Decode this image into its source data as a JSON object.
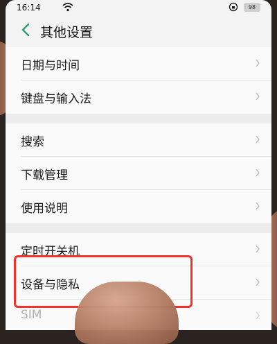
{
  "status": {
    "time": "16:14",
    "battery": "98"
  },
  "header": {
    "title": "其他设置"
  },
  "groups": [
    {
      "items": [
        {
          "label": "日期与时间"
        },
        {
          "label": "键盘与输入法"
        }
      ]
    },
    {
      "items": [
        {
          "label": "搜索"
        },
        {
          "label": "下载管理"
        },
        {
          "label": "使用说明"
        }
      ]
    },
    {
      "items": [
        {
          "label": "定时开关机"
        },
        {
          "label": "设备与隐私"
        },
        {
          "label": "SIM"
        }
      ]
    }
  ],
  "colors": {
    "accent": "#2e9e6e",
    "highlight": "#f3302c"
  }
}
